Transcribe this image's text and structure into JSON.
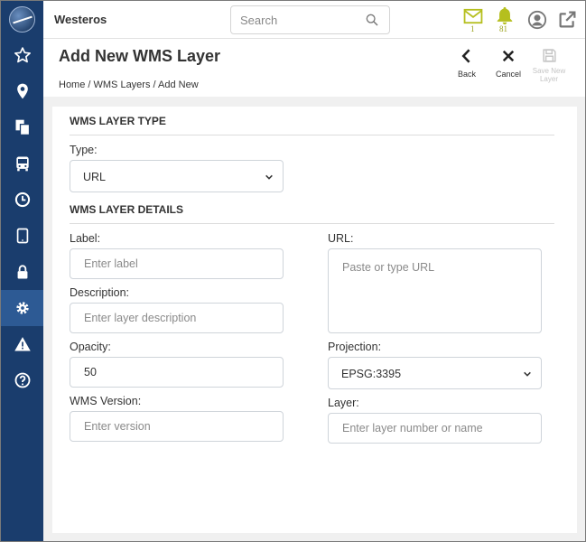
{
  "topbar": {
    "app_name": "Westeros",
    "search_placeholder": "Search",
    "mail_count": "1",
    "alerts_count": "81"
  },
  "header": {
    "title": "Add New WMS Layer",
    "breadcrumb": "Home / WMS Layers / Add New",
    "actions": {
      "back": "Back",
      "cancel": "Cancel",
      "save_line1": "Save New",
      "save_line2": "Layer"
    }
  },
  "sidebar": {
    "items": [
      "star-icon",
      "location-pin-icon",
      "documents-icon",
      "bus-icon",
      "clock-icon",
      "tablet-icon",
      "lock-icon",
      "gear-icon",
      "warning-icon",
      "help-icon"
    ],
    "active": "gear-icon"
  },
  "form": {
    "type_section": "WMS LAYER TYPE",
    "type_label": "Type:",
    "type_value": "URL",
    "details_section": "WMS LAYER DETAILS",
    "label_label": "Label:",
    "label_placeholder": "Enter label",
    "description_label": "Description:",
    "description_placeholder": "Enter layer description",
    "opacity_label": "Opacity:",
    "opacity_value": "50",
    "version_label": "WMS Version:",
    "version_placeholder": "Enter version",
    "url_label": "URL:",
    "url_placeholder": "Paste or type URL",
    "projection_label": "Projection:",
    "projection_value": "EPSG:3395",
    "layer_label": "Layer:",
    "layer_placeholder": "Enter layer number or name"
  },
  "colors": {
    "sidebar": "#1a3d6d",
    "sidebar_active": "#2d5a94",
    "notification": "#b5bf1e"
  }
}
